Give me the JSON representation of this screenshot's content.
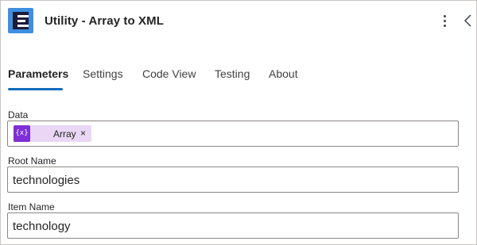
{
  "header": {
    "title": "Utility - Array to XML",
    "app_icon": "app-icon",
    "icon_color": "#3f8fe0"
  },
  "tabs": [
    {
      "label": "Parameters",
      "active": true
    },
    {
      "label": "Settings",
      "active": false
    },
    {
      "label": "Code View",
      "active": false
    },
    {
      "label": "Testing",
      "active": false
    },
    {
      "label": "About",
      "active": false
    }
  ],
  "accent_color": "#0f6cbd",
  "fields": {
    "data": {
      "label": "Data",
      "token": {
        "icon_text": "{x}",
        "label": "Array",
        "remove": "×",
        "color": "#7e2fd6"
      }
    },
    "root_name": {
      "label": "Root Name",
      "value": "technologies"
    },
    "item_name": {
      "label": "Item Name",
      "value": "technology"
    }
  }
}
